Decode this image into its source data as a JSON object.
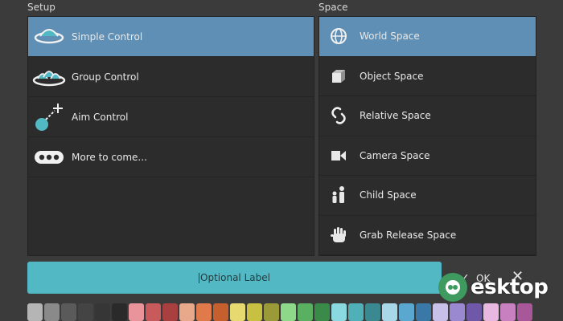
{
  "setup": {
    "title": "Setup",
    "items": [
      {
        "label": "Simple Control",
        "icon": "saucer-icon",
        "selected": true
      },
      {
        "label": "Group Control",
        "icon": "saucer-group-icon",
        "selected": false
      },
      {
        "label": "Aim Control",
        "icon": "aim-icon",
        "selected": false
      },
      {
        "label": "More to come...",
        "icon": "ellipsis-pill-icon",
        "selected": false
      }
    ]
  },
  "space": {
    "title": "Space",
    "items": [
      {
        "label": "World Space",
        "icon": "globe-icon",
        "selected": true
      },
      {
        "label": "Object Space",
        "icon": "cube-icon",
        "selected": false
      },
      {
        "label": "Relative Space",
        "icon": "chain-link-icon",
        "selected": false
      },
      {
        "label": "Camera Space",
        "icon": "video-camera-icon",
        "selected": false
      },
      {
        "label": "Child Space",
        "icon": "child-icon",
        "selected": false
      },
      {
        "label": "Grab Release Space",
        "icon": "hand-icon",
        "selected": false
      }
    ]
  },
  "label_field": {
    "value": "Optional Label"
  },
  "actions": {
    "ok": "OK"
  },
  "colors": {
    "selected": "#5f8fb4",
    "accent": "#52b8c4",
    "swatches": [
      "#b5b5b5",
      "#8a8a8a",
      "#5a5a5a",
      "#444444",
      "#363636",
      "#2a2a2a",
      "#e8949a",
      "#c95a5c",
      "#a8403f",
      "#e8a88a",
      "#e07a4a",
      "#c5602e",
      "#e8d870",
      "#c8c040",
      "#9a9a38",
      "#8ed88a",
      "#58b060",
      "#3a8a4a",
      "#8ad8e0",
      "#50b0b8",
      "#3a8890",
      "#a8d8e8",
      "#5aa8d0",
      "#3a78a8",
      "#c8c0e8",
      "#9a88d0",
      "#7058a8",
      "#e8b8e0",
      "#c880c0",
      "#a85898"
    ]
  },
  "watermark": {
    "text": "esktop"
  }
}
